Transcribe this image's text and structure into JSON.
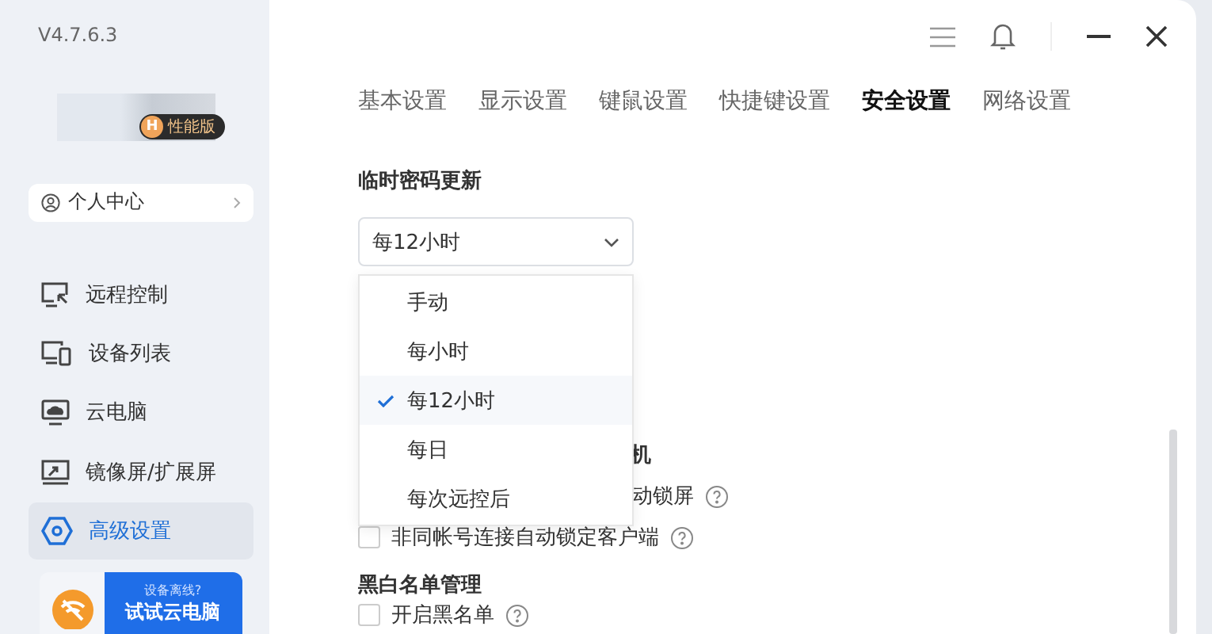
{
  "sidebar": {
    "version": "V4.7.6.3",
    "badge": {
      "letter": "H",
      "label": "性能版"
    },
    "profile_button": "个人中心",
    "items": [
      {
        "label": "远程控制",
        "selected": false
      },
      {
        "label": "设备列表",
        "selected": false
      },
      {
        "label": "云电脑",
        "selected": false
      },
      {
        "label": "镜像屏/扩展屏",
        "selected": false
      },
      {
        "label": "高级设置",
        "selected": true
      }
    ],
    "promo": {
      "caption": "设备离线?",
      "title": "试试云电脑"
    }
  },
  "tabs": [
    {
      "label": "基本设置",
      "selected": false
    },
    {
      "label": "显示设置",
      "selected": false
    },
    {
      "label": "键鼠设置",
      "selected": false
    },
    {
      "label": "快捷键设置",
      "selected": false
    },
    {
      "label": "安全设置",
      "selected": true
    },
    {
      "label": "网络设置",
      "selected": false
    }
  ],
  "temp_password": {
    "heading": "临时密码更新",
    "value": "每12小时",
    "options": [
      {
        "label": "手动",
        "selected": false
      },
      {
        "label": "每小时",
        "selected": false
      },
      {
        "label": "每12小时",
        "selected": true
      },
      {
        "label": "每日",
        "selected": false
      },
      {
        "label": "每次远控后",
        "selected": false
      }
    ]
  },
  "lock_section": {
    "heading": "机",
    "rows": [
      {
        "kind": "partial",
        "label": "动锁屏"
      },
      {
        "kind": "checkbox",
        "label": "非同帐号连接自动锁定客户端",
        "checked": false
      }
    ]
  },
  "blacklist": {
    "heading": "黑白名单管理",
    "rows": [
      {
        "label": "开启黑名单",
        "checked": false
      }
    ]
  }
}
